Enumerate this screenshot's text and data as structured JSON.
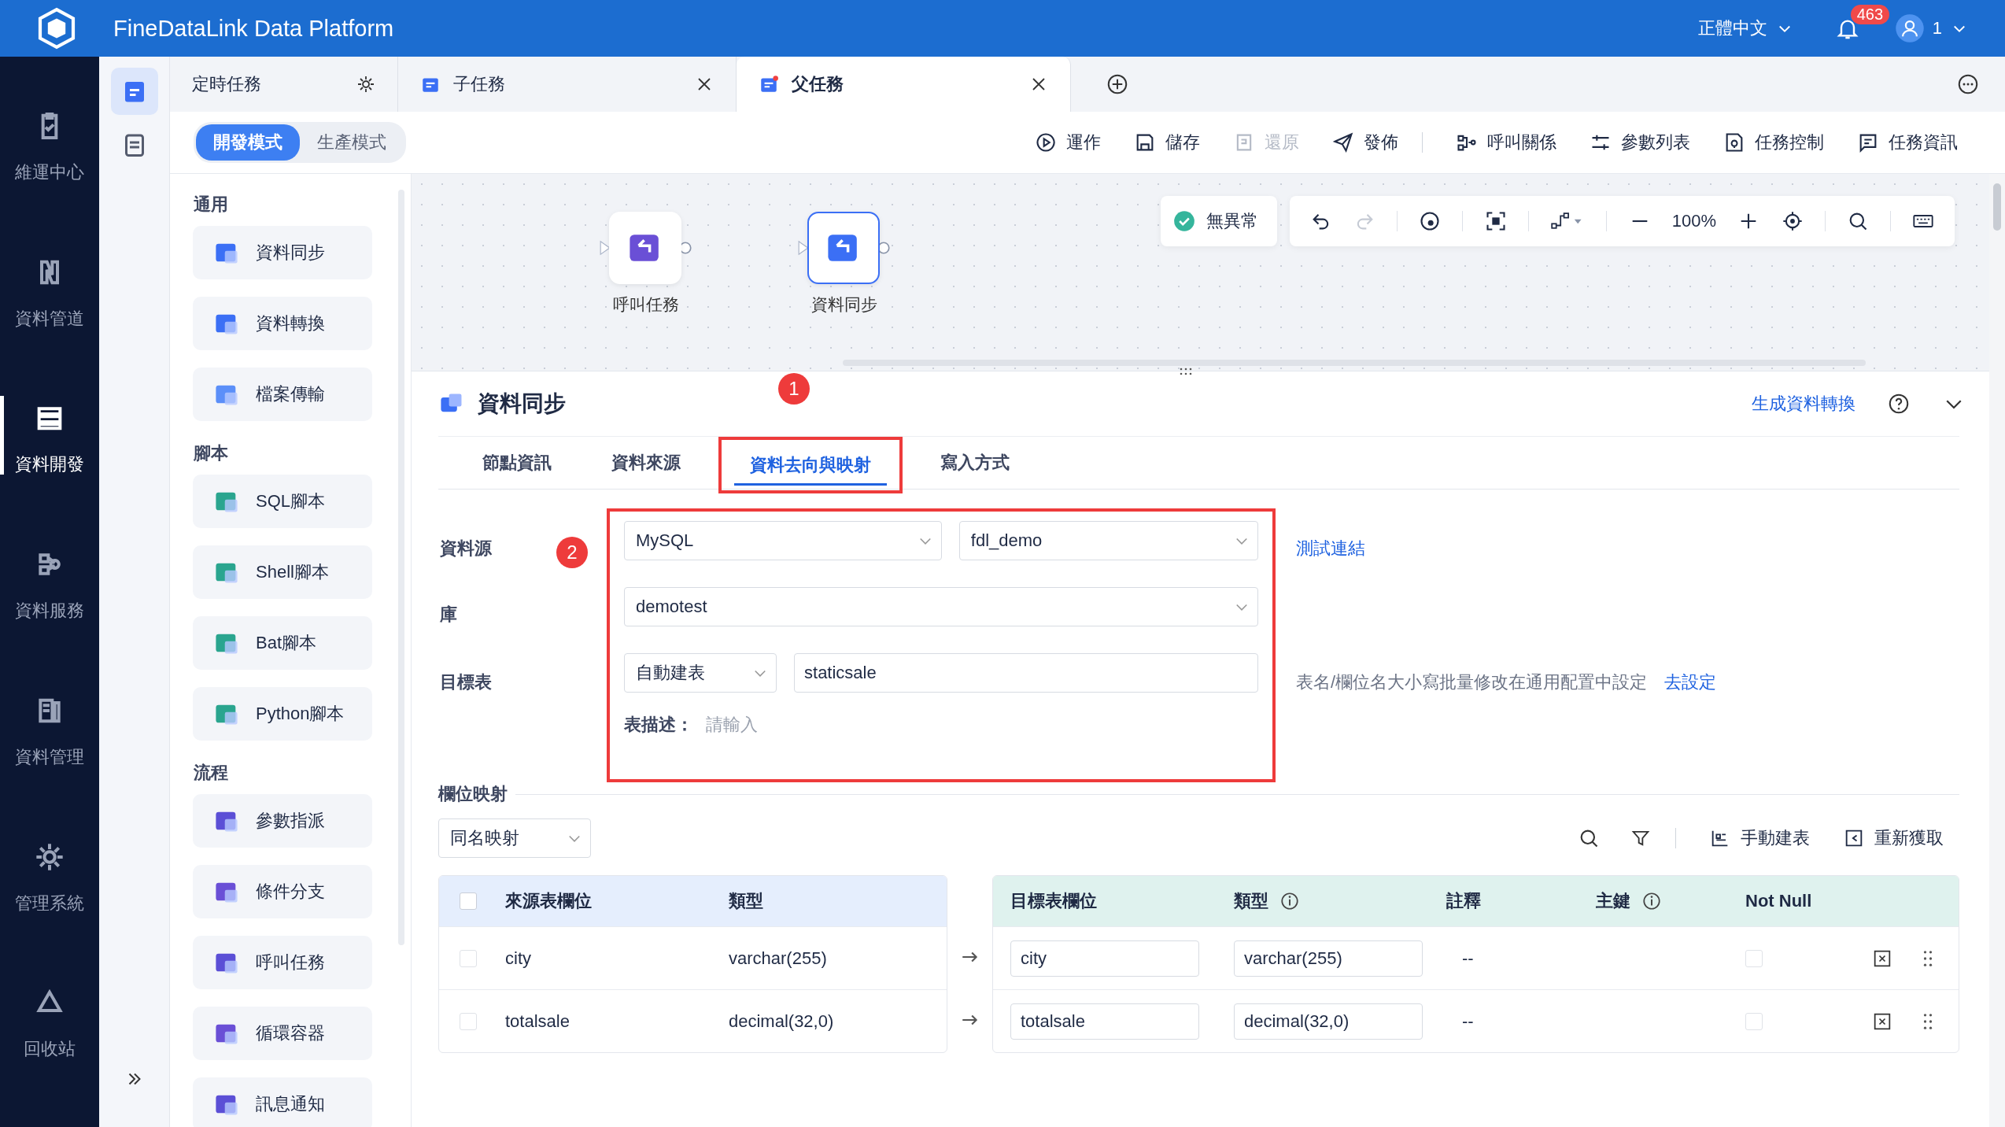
{
  "app": {
    "title": "FineDataLink Data Platform",
    "language": "正體中文",
    "notifications": "463",
    "user": "1"
  },
  "nav": [
    {
      "label": "維運中心",
      "selected": false
    },
    {
      "label": "資料管道",
      "selected": false
    },
    {
      "label": "資料開發",
      "selected": true
    },
    {
      "label": "資料服務",
      "selected": false
    },
    {
      "label": "資料管理",
      "selected": false
    },
    {
      "label": "管理系統",
      "selected": false
    },
    {
      "label": "回收站",
      "selected": false
    }
  ],
  "side_tools": [
    {
      "selected": true
    },
    {
      "selected": false
    }
  ],
  "tabs": [
    {
      "label": "定時任務",
      "kind": "settings",
      "selected": false
    },
    {
      "label": "子任務",
      "kind": "task",
      "selected": false
    },
    {
      "label": "父任務",
      "kind": "task",
      "selected": true
    }
  ],
  "modes": [
    {
      "label": "開發模式",
      "selected": true
    },
    {
      "label": "生產模式",
      "selected": false
    }
  ],
  "actions": [
    {
      "label": "運作",
      "disabled": false
    },
    {
      "label": "儲存",
      "disabled": false
    },
    {
      "label": "還原",
      "disabled": true
    },
    {
      "label": "發佈",
      "disabled": false
    },
    {
      "label": "呼叫關係",
      "disabled": false
    },
    {
      "label": "參數列表",
      "disabled": false
    },
    {
      "label": "任務控制",
      "disabled": false
    },
    {
      "label": "任務資訊",
      "disabled": false
    }
  ],
  "palette": [
    {
      "title": "通用",
      "items": [
        "資料同步",
        "資料轉換",
        "檔案傳輸"
      ]
    },
    {
      "title": "腳本",
      "items": [
        "SQL腳本",
        "Shell腳本",
        "Bat腳本",
        "Python腳本"
      ]
    },
    {
      "title": "流程",
      "items": [
        "參數指派",
        "條件分支",
        "呼叫任務",
        "循環容器",
        "訊息通知"
      ]
    }
  ],
  "canvas": {
    "status": "無異常",
    "zoom": "100%",
    "nodes": [
      {
        "label": "呼叫任務",
        "selected": false
      },
      {
        "label": "資料同步",
        "selected": true
      }
    ]
  },
  "panel": {
    "title": "資料同步",
    "generate_link": "生成資料轉換",
    "tabs": [
      {
        "label": "節點資訊",
        "selected": false,
        "highlighted": false
      },
      {
        "label": "資料來源",
        "selected": false,
        "highlighted": false
      },
      {
        "label": "資料去向與映射",
        "selected": true,
        "highlighted": true
      },
      {
        "label": "寫入方式",
        "selected": false,
        "highlighted": false
      }
    ],
    "callouts": [
      "1",
      "2"
    ],
    "form": {
      "highlighted": true,
      "source_label": "資料源",
      "source_type": "MySQL",
      "connection": "fdl_demo",
      "test_link": "測試連結",
      "db_label": "庫",
      "database": "demotest",
      "table_label": "目標表",
      "table_mode": "自動建表",
      "table_name": "staticsale",
      "hint": "表名/欄位名大小寫批量修改在通用配置中設定",
      "hint_link": "去設定",
      "desc_label": "表描述：",
      "desc_placeholder": "請輸入"
    },
    "mapping": {
      "title": "欄位映射",
      "strategy": "同名映射",
      "manual": "手動建表",
      "refresh": "重新獲取",
      "header_checked": false,
      "source_columns": [
        "來源表欄位",
        "類型"
      ],
      "target_columns": [
        {
          "label": "目標表欄位",
          "info": false
        },
        {
          "label": "類型",
          "info": true
        },
        {
          "label": "註釋",
          "info": false
        },
        {
          "label": "主鍵",
          "info": true
        },
        {
          "label": "Not Null",
          "info": false
        }
      ],
      "rows": [
        {
          "checked": false,
          "source_field": "city",
          "source_type": "varchar(255)",
          "target_field": "city",
          "target_type": "varchar(255)",
          "comment": "--",
          "not_null": false
        },
        {
          "checked": false,
          "source_field": "totalsale",
          "source_type": "decimal(32,0)",
          "target_field": "totalsale",
          "target_type": "decimal(32,0)",
          "comment": "--",
          "not_null": false
        }
      ]
    }
  }
}
